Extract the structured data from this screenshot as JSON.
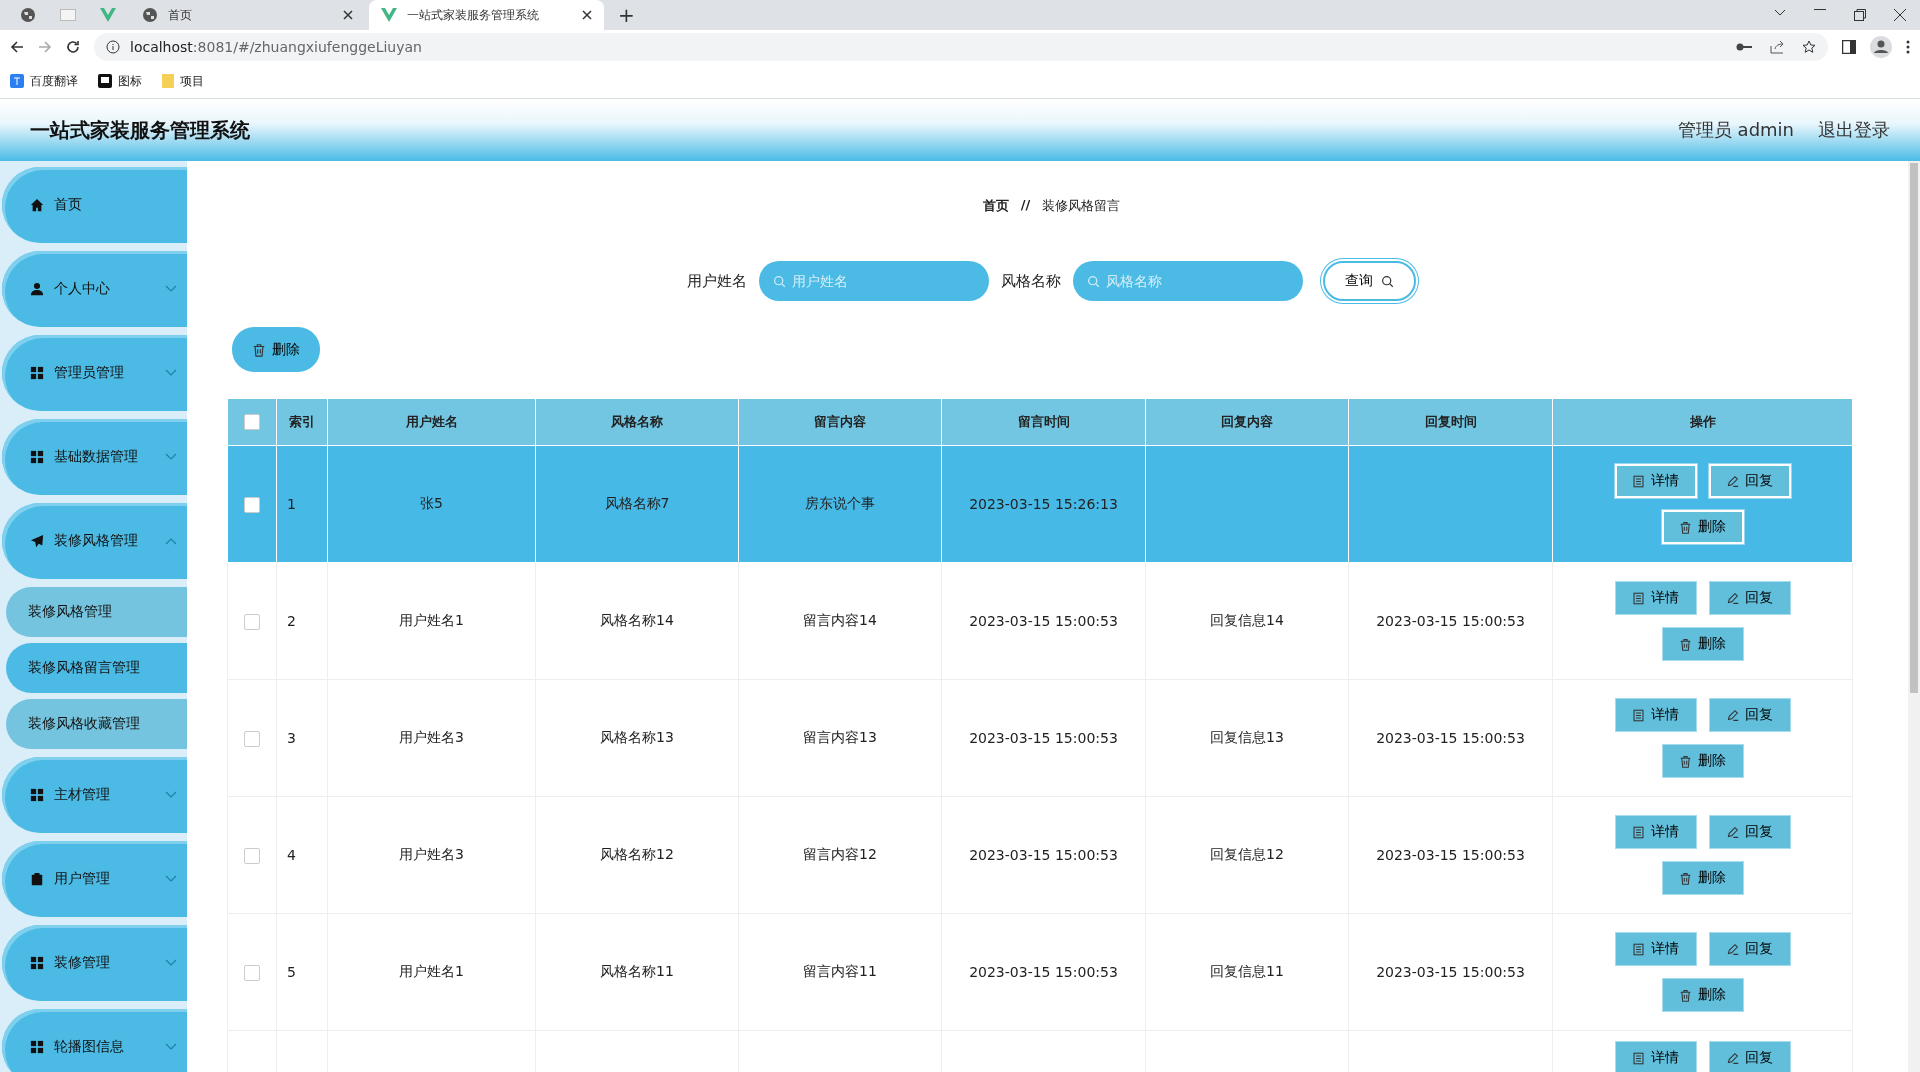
{
  "browser": {
    "tabs": [
      {
        "kind": "pinned",
        "selected": false
      },
      {
        "kind": "pinned",
        "selected": false
      },
      {
        "kind": "pinned",
        "selected": false
      },
      {
        "kind": "page",
        "title": "首页",
        "selected": false
      },
      {
        "kind": "page",
        "title": "一站式家装服务管理系统",
        "selected": true
      }
    ],
    "url_host": "localhost",
    "url_path": ":8081/#/zhuangxiufenggeLiuyan",
    "new_tab": "+",
    "bookmarks": [
      "百度翻译",
      "图标",
      "项目"
    ]
  },
  "header": {
    "title": "一站式家装服务管理系统",
    "user": "管理员 admin",
    "logout": "退出登录"
  },
  "sidebar": {
    "items": [
      {
        "kind": "link",
        "label": "首页"
      },
      {
        "kind": "group",
        "label": "个人中心",
        "expanded": false
      },
      {
        "kind": "group",
        "label": "管理员管理",
        "expanded": false
      },
      {
        "kind": "group",
        "label": "基础数据管理",
        "expanded": false
      },
      {
        "kind": "group",
        "label": "装修风格管理",
        "expanded": true,
        "children": [
          {
            "label": "装修风格管理",
            "selected": false
          },
          {
            "label": "装修风格留言管理",
            "selected": true
          },
          {
            "label": "装修风格收藏管理",
            "selected": false
          }
        ]
      },
      {
        "kind": "group",
        "label": "主材管理",
        "expanded": false
      },
      {
        "kind": "group",
        "label": "用户管理",
        "expanded": false
      },
      {
        "kind": "group",
        "label": "装修管理",
        "expanded": false
      },
      {
        "kind": "group",
        "label": "轮播图信息",
        "expanded": false
      }
    ]
  },
  "breadcrumb": {
    "items": [
      "首页",
      "装修风格留言"
    ],
    "separator": "//"
  },
  "search": {
    "fields": [
      {
        "label": "用户姓名",
        "placeholder": "用户姓名"
      },
      {
        "label": "风格名称",
        "placeholder": "风格名称"
      }
    ],
    "button": "查询"
  },
  "delete_button": "删除",
  "table": {
    "columns": [
      "索引",
      "用户姓名",
      "风格名称",
      "留言内容",
      "留言时间",
      "回复内容",
      "回复时间",
      "操作"
    ],
    "header_checked": false,
    "rows": [
      {
        "selected": true,
        "checked": false,
        "cells": [
          "1",
          "张5",
          "风格名称7",
          "房东说个事",
          "2023-03-15 15:26:13",
          "",
          ""
        ],
        "actions": [
          "详情",
          "回复",
          "删除"
        ]
      },
      {
        "selected": false,
        "checked": false,
        "cells": [
          "2",
          "用户姓名1",
          "风格名称14",
          "留言内容14",
          "2023-03-15 15:00:53",
          "回复信息14",
          "2023-03-15 15:00:53"
        ],
        "actions": [
          "详情",
          "回复",
          "删除"
        ]
      },
      {
        "selected": false,
        "checked": false,
        "cells": [
          "3",
          "用户姓名3",
          "风格名称13",
          "留言内容13",
          "2023-03-15 15:00:53",
          "回复信息13",
          "2023-03-15 15:00:53"
        ],
        "actions": [
          "详情",
          "回复",
          "删除"
        ]
      },
      {
        "selected": false,
        "checked": false,
        "cells": [
          "4",
          "用户姓名3",
          "风格名称12",
          "留言内容12",
          "2023-03-15 15:00:53",
          "回复信息12",
          "2023-03-15 15:00:53"
        ],
        "actions": [
          "详情",
          "回复",
          "删除"
        ]
      },
      {
        "selected": false,
        "checked": false,
        "cells": [
          "5",
          "用户姓名1",
          "风格名称11",
          "留言内容11",
          "2023-03-15 15:00:53",
          "回复信息11",
          "2023-03-15 15:00:53"
        ],
        "actions": [
          "详情",
          "回复",
          "删除"
        ]
      },
      {
        "selected": false,
        "cells": [],
        "actions": [
          "详情",
          "回复"
        ]
      }
    ]
  }
}
